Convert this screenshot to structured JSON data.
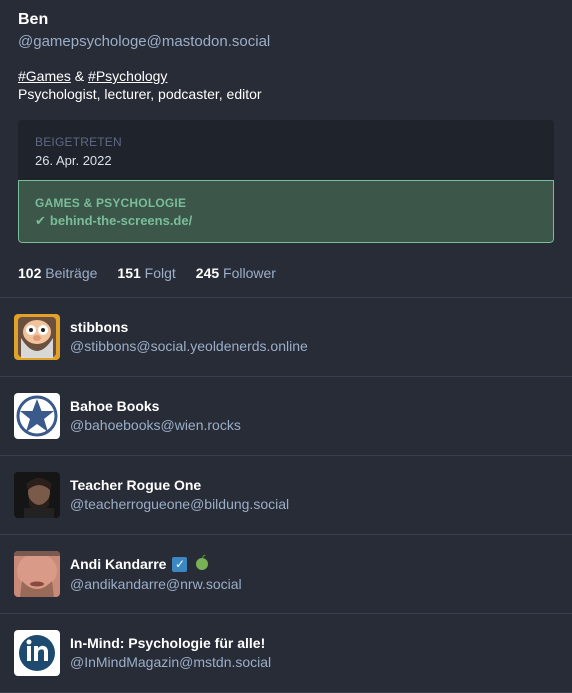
{
  "profile": {
    "name": "Ben",
    "handle": "@gamepsychologe@mastodon.social",
    "bio_tag1": "#Games",
    "bio_amp": " & ",
    "bio_tag2": "#Psychology",
    "bio_line2": "Psychologist, lecturer, podcaster, editor"
  },
  "fields": {
    "joined_label": "BEIGETRETEN",
    "joined_value": "26. Apr. 2022",
    "verified_label": "GAMES & PSYCHOLOGIE",
    "verified_value": "behind-the-screens.de/",
    "verified_color": "#79bd9a"
  },
  "counts": {
    "posts_num": "102",
    "posts_label": "Beiträge",
    "following_num": "151",
    "following_label": "Folgt",
    "followers_num": "245",
    "followers_label": "Follower"
  },
  "accounts": [
    {
      "name": "stibbons",
      "handle": "@stibbons@social.yeoldenerds.online",
      "avatar": "wizard-avatar"
    },
    {
      "name": "Bahoe Books",
      "handle": "@bahoebooks@wien.rocks",
      "avatar": "star-logo-avatar"
    },
    {
      "name": "Teacher Rogue One",
      "handle": "@teacherrogueone@bildung.social",
      "avatar": "portrait-avatar"
    },
    {
      "name": "Andi Kandarre",
      "handle": "@andikandarre@nrw.social",
      "avatar": "face-avatar",
      "badges": [
        "check-box-icon",
        "green-apple-icon"
      ]
    },
    {
      "name": "In-Mind: Psychologie für alle!",
      "handle": "@InMindMagazin@mstdn.social",
      "avatar": "in-logo-avatar"
    }
  ],
  "colors": {
    "background": "#282c37",
    "secondary_text": "#9baec8",
    "verified_green": "#79bd9a"
  }
}
